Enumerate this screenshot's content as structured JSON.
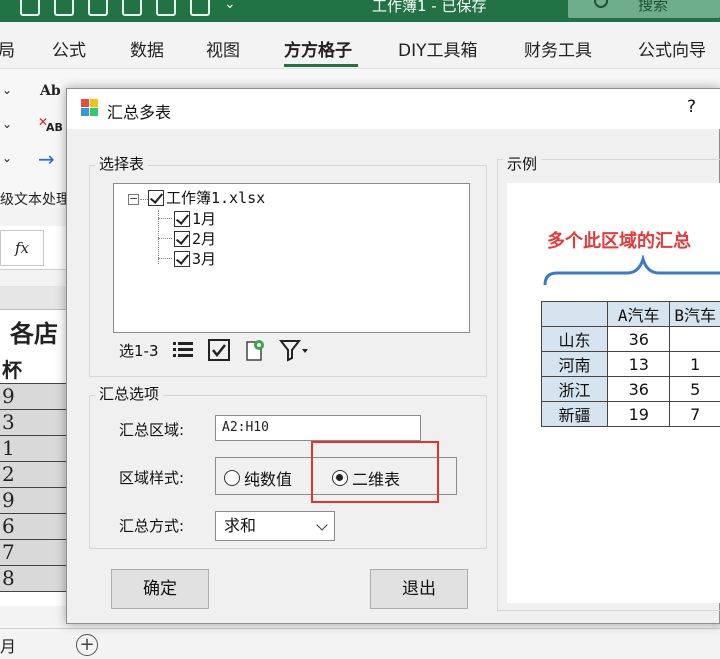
{
  "excel": {
    "title": "工作簿1 - 已保存",
    "search": "搜索",
    "tabs": [
      {
        "label": "局"
      },
      {
        "label": "公式"
      },
      {
        "label": "数据"
      },
      {
        "label": "视图"
      },
      {
        "label": "方方格子"
      },
      {
        "label": "DIY工具箱"
      },
      {
        "label": "财务工具"
      },
      {
        "label": "公式向导"
      }
    ],
    "ribbon": {
      "text_process": "级文本处理",
      "ab_label": "Ab",
      "ab2_label": "AB"
    },
    "fx": "fx",
    "sheet": {
      "title_cell": "各店",
      "rows": [
        "杯",
        "9",
        "3",
        "1",
        "2",
        "9",
        "6",
        "7",
        "8"
      ]
    },
    "sheet_tab": "月",
    "add_sheet": "+"
  },
  "dialog": {
    "title": "汇总多表",
    "help": "?",
    "select_group": {
      "label": "选择表",
      "tree": {
        "root": "工作簿1.xlsx",
        "children": [
          "1月",
          "2月",
          "3月"
        ]
      },
      "selection_label": "选1-3"
    },
    "options_group": {
      "label": "汇总选项",
      "range_label": "汇总区域:",
      "range_value": "A2:H10",
      "style_label": "区域样式:",
      "style_options": [
        "纯数值",
        "二维表"
      ],
      "style_selected": "二维表",
      "method_label": "汇总方式:",
      "method_value": "求和"
    },
    "ok_label": "确定",
    "exit_label": "退出",
    "example": {
      "label": "示例",
      "caption": "多个此区域的汇总",
      "col_headers": [
        "A汽车",
        "B汽车"
      ],
      "rows": [
        {
          "label": "山东",
          "values": [
            "36",
            ""
          ]
        },
        {
          "label": "河南",
          "values": [
            "13",
            "1"
          ]
        },
        {
          "label": "浙江",
          "values": [
            "36",
            "5"
          ]
        },
        {
          "label": "新疆",
          "values": [
            "19",
            "7"
          ]
        }
      ]
    }
  },
  "colors": {
    "excel_green": "#217346",
    "highlight_red": "#e8302c",
    "example_caption": "#e33b3b",
    "brace_blue": "#3a7ac8",
    "table_header": "#d6e4ef"
  }
}
